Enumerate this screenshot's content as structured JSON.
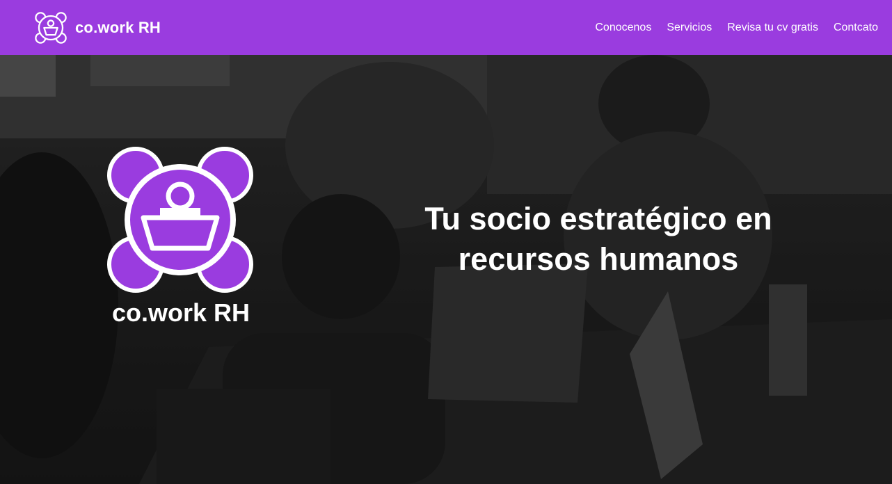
{
  "colors": {
    "brand": "#9a3cdf",
    "nav_text": "#ffffff",
    "hero_overlay": "#2a2a2a"
  },
  "navbar": {
    "brand_name": "co.work RH",
    "logo_icon": "cowork-logo-icon",
    "links": [
      {
        "label": "Conocenos"
      },
      {
        "label": "Servicios"
      },
      {
        "label": "Revisa tu cv gratis"
      },
      {
        "label": "Contcato"
      }
    ]
  },
  "hero": {
    "logo_icon": "cowork-logo-icon",
    "logo_name": "co.work RH",
    "headline_line1": "Tu socio estratégico en",
    "headline_line2": "recursos humanos",
    "background_image": "coworking-team-photo"
  }
}
